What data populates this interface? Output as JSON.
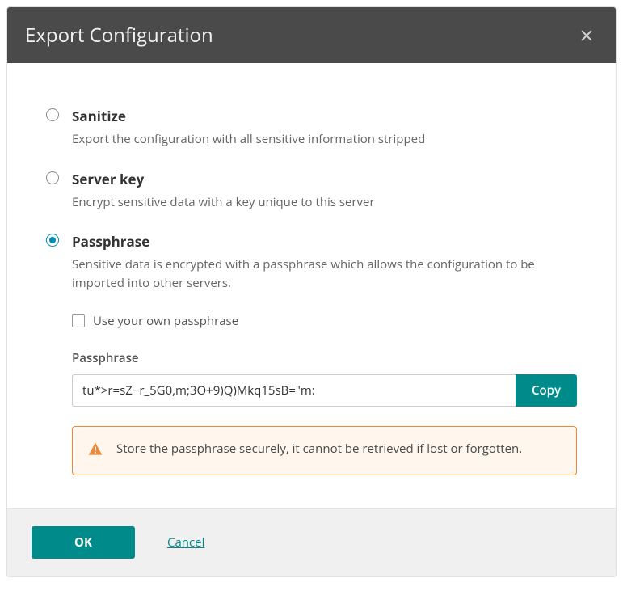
{
  "dialog": {
    "title": "Export Configuration"
  },
  "options": {
    "sanitize": {
      "title": "Sanitize",
      "desc": "Export the configuration with all sensitive information stripped"
    },
    "serverKey": {
      "title": "Server key",
      "desc": "Encrypt sensitive data with a key unique to this server"
    },
    "passphrase": {
      "title": "Passphrase",
      "desc": "Sensitive data is encrypted with a passphrase which allows the configuration to be imported into other servers."
    }
  },
  "checkbox": {
    "label": "Use your own passphrase"
  },
  "passphraseField": {
    "label": "Passphrase",
    "value": "tu*>r=sZ−r_5G0,m;3O+9)Q)Mkq15sB=\"m:",
    "copyLabel": "Copy"
  },
  "alert": {
    "text": "Store the passphrase securely, it cannot be retrieved if lost or forgotten."
  },
  "footer": {
    "ok": "OK",
    "cancel": "Cancel"
  },
  "colors": {
    "primary": "#008b8b",
    "headerBg": "#4a4a4a",
    "warning": "#ed8936"
  }
}
